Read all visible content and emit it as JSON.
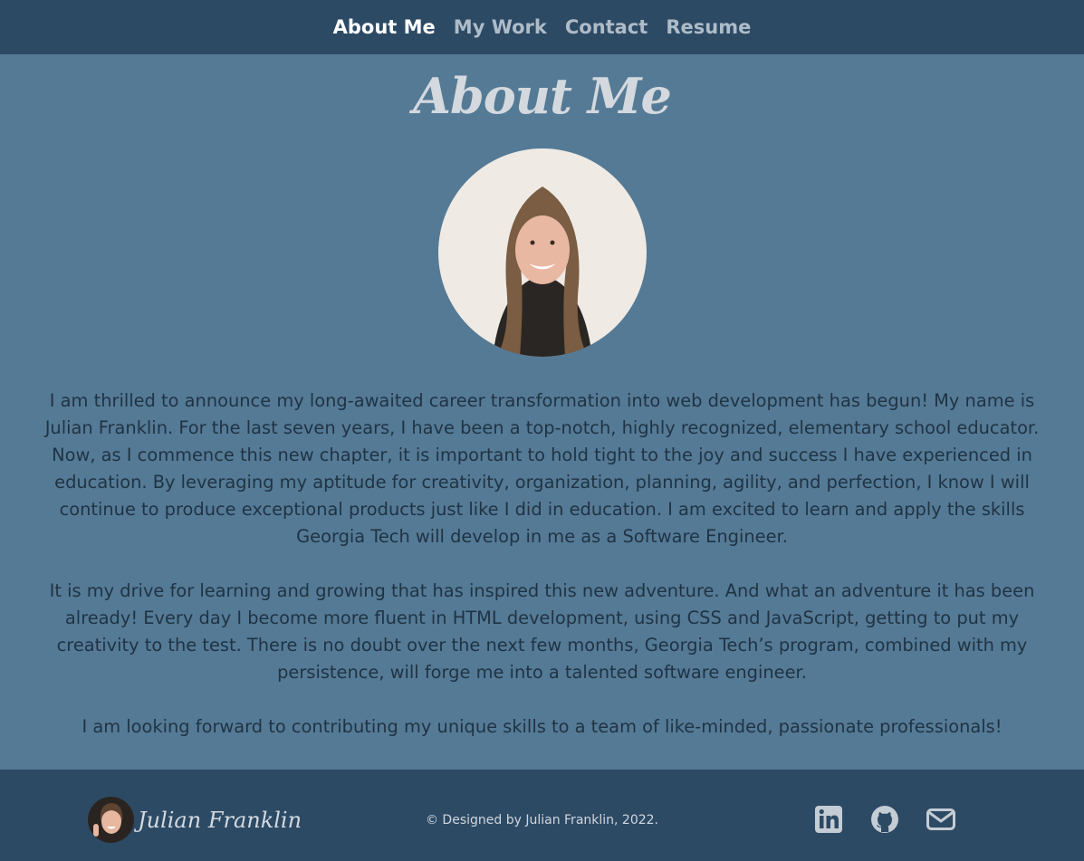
{
  "nav": {
    "items": [
      {
        "label": "About Me",
        "active": true
      },
      {
        "label": "My Work",
        "active": false
      },
      {
        "label": "Contact",
        "active": false
      },
      {
        "label": "Resume",
        "active": false
      }
    ]
  },
  "about": {
    "title": "About Me",
    "paragraphs": [
      "I am thrilled to announce my long-awaited career transformation into web development has begun! My name is Julian Franklin. For the last seven years, I have been a top-notch, highly recognized, elementary school educator. Now, as I commence this new chapter, it is important to hold tight to the joy and success I have experienced in education. By leveraging my aptitude for creativity, organization, planning, agility, and perfection, I know I will continue to produce exceptional products just like I did in education. I am excited to learn and apply the skills Georgia Tech will develop in me as a Software Engineer.",
      "It is my drive for learning and growing that has inspired this new adventure. And what an adventure it has been already! Every day I become more fluent in HTML development, using CSS and JavaScript, getting to put my creativity to the test. There is no doubt over the next few months, Georgia Tech’s program, combined with my persistence, will forge me into a talented software engineer.",
      "I am looking forward to contributing my unique skills to a team of like-minded, passionate professionals!"
    ]
  },
  "footer": {
    "brand_name": "Julian Franklin",
    "copyright": "© Designed by Julian Franklin, 2022.",
    "social_icons": [
      "linkedin-icon",
      "github-icon",
      "envelope-icon"
    ]
  },
  "colors": {
    "header_bg": "#2d4a65",
    "page_bg": "#557a95",
    "nav_active": "#ffffff",
    "nav_inactive": "#aebcc8",
    "body_text": "#1f3344",
    "title_text": "#d3d9df"
  }
}
